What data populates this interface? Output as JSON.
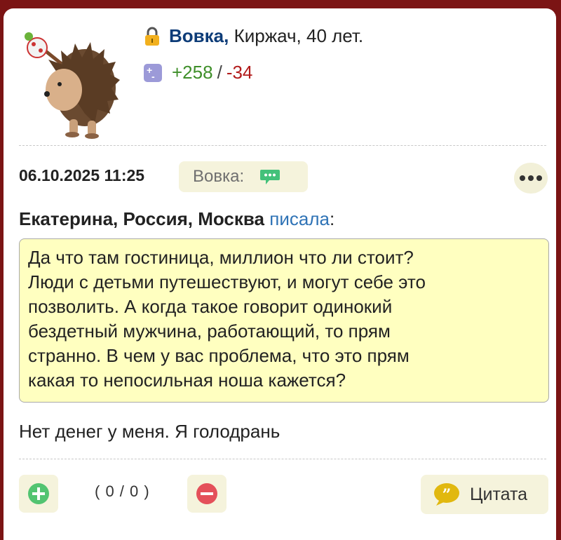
{
  "user": {
    "name": "Вовка,",
    "info": "Киржач, 40 лет.",
    "rating_plus": "+258",
    "rating_sep": "/",
    "rating_minus": "-34"
  },
  "post": {
    "datetime": "06.10.2025 11:25",
    "address_button": "Вовка:",
    "quote_author": "Екатерина, Россия, Москва",
    "quote_wrote": "писала",
    "quote_colon": ":",
    "quote_text": [
      "Да что там гостиница, миллион что ли стоит?",
      "Люди с детьми путешествуют, и могут себе это",
      "позволить. А когда такое говорит одинокий",
      "бездетный мужчина, работающий, то прям",
      "странно. В чем у вас проблема, что это прям",
      "какая то непосильная ноша кажется?"
    ],
    "reply_text": "Нет денег у меня. Я голодрань"
  },
  "footer": {
    "votes": "( 0 / 0 )",
    "cite_label": "Цитата"
  },
  "icons": {
    "lock": "lock-icon",
    "rating": "rating-icon",
    "chat": "chat-bubble-icon",
    "more": "more-dots-icon",
    "vote_up": "plus-circle-icon",
    "vote_down": "minus-circle-icon",
    "quote": "quote-icon"
  },
  "colors": {
    "frame": "#7b1414",
    "username": "#0d3c78",
    "plus": "#3f8f2a",
    "minus": "#b21b1b",
    "quote_bg": "#ffffc0",
    "button_bg": "#f5f3dc",
    "link": "#2f73b6"
  }
}
